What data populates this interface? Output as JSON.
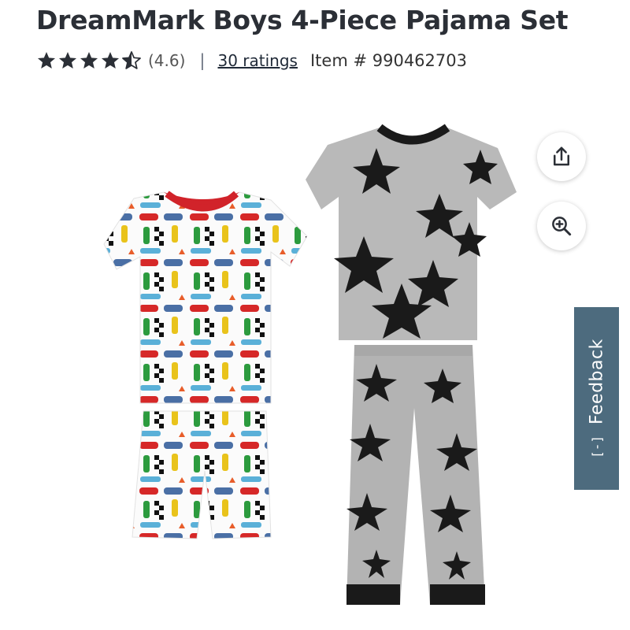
{
  "product": {
    "title": "DreamMark Boys 4-Piece Pajama Set",
    "rating": 4.6,
    "rating_text": "(4.6)",
    "separator": "|",
    "ratings_link": "30 ratings",
    "item_number": "Item # 990462703",
    "star_color": "#2b2f36"
  },
  "image": {
    "alt": "DreamMark Boys 4-Piece Pajama Set"
  },
  "actions": {
    "share_icon": "share-icon",
    "zoom_icon": "zoom-in-icon"
  },
  "feedback": {
    "label": "Feedback",
    "icon": "[-]",
    "color": "#4d6b7e"
  }
}
